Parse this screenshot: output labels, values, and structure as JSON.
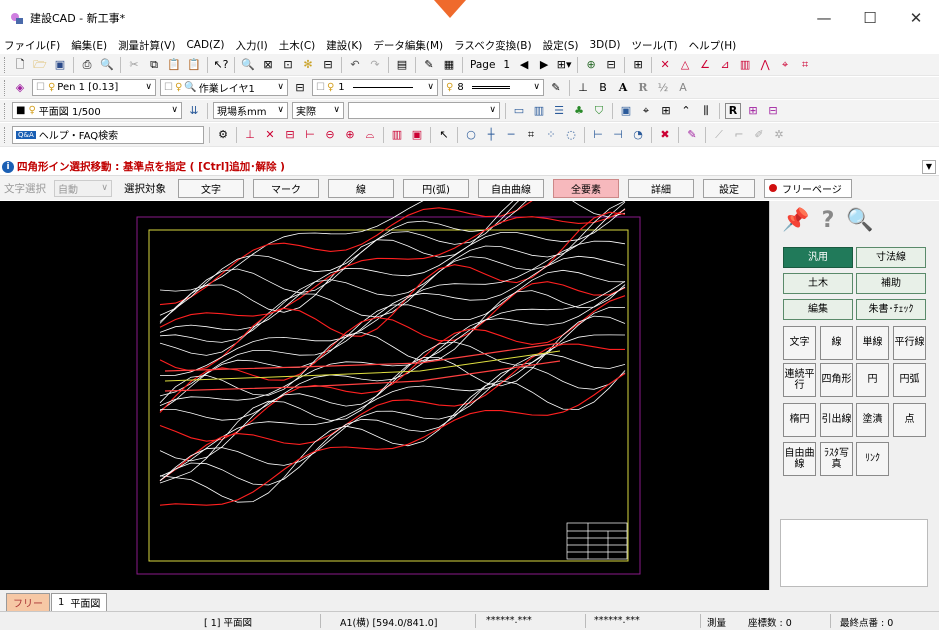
{
  "window": {
    "title": "建設CAD - 新工事*",
    "minimize": "—",
    "maximize": "☐",
    "close": "✕"
  },
  "menu": [
    "ファイル(F)",
    "編集(E)",
    "測量計算(V)",
    "CAD(Z)",
    "入力(I)",
    "土木(C)",
    "建設(K)",
    "データ編集(M)",
    "ラスベク変換(B)",
    "設定(S)",
    "3D(D)",
    "ツール(T)",
    "ヘルプ(H)"
  ],
  "toolbar1": {
    "page_label": "Page",
    "page_number": "1"
  },
  "toolbar2": {
    "pen": "Pen 1 [0.13]",
    "layer": "作業レイヤ1",
    "line_num": "1",
    "pen_width": "8"
  },
  "toolbar3": {
    "drawing": "平面図 1/500",
    "unit": "現場系mm",
    "scale_mode": "実際",
    "extra": ""
  },
  "toolbar4": {
    "help_search": "ヘルプ・FAQ検索",
    "help_icon": "Q&A"
  },
  "status_message": "四角形イン選択移動 : 基準点を指定 ( [Ctrl]追加･解除 )",
  "selection_bar": {
    "text_select_label": "文字選択",
    "text_select_value": "自動",
    "target_label": "選択対象",
    "buttons": [
      "文字",
      "マーク",
      "線",
      "円(弧)",
      "自由曲線",
      "全要素",
      "詳細",
      "設定"
    ],
    "free_page": "フリーページ"
  },
  "panel": {
    "categories": [
      "汎用",
      "寸法線",
      "土木",
      "補助",
      "編集",
      "朱書･ﾁｪｯｸ"
    ],
    "tools": [
      [
        "文字",
        "線",
        "単線",
        "平行線"
      ],
      [
        "連続平行",
        "四角形",
        "円",
        "円弧"
      ],
      [
        "楕円",
        "引出線",
        "塗潰",
        "点"
      ],
      [
        "自由曲線",
        "ﾗｽﾀ写真",
        "ﾘﾝｸ"
      ]
    ]
  },
  "tabs": {
    "free": "フリー",
    "number": "1",
    "name": "平面図"
  },
  "status": {
    "sheet": "[ 1]  平面図",
    "paper": "A1(横) [594.0/841.0]",
    "coord1": "******.***",
    "coord2": "******.***",
    "mode": "測量",
    "coord_count": "座標数 : 0",
    "last_point": "最終点番 : 0"
  },
  "colors": {
    "accent": "#ef6a2c",
    "panel_selected": "#217a5a",
    "canvas_bg": "#000000",
    "frame_outer": "#8a1a8a",
    "frame_inner": "#d8d840",
    "contour_white": "#ffffff",
    "contour_red": "#ff2020"
  }
}
